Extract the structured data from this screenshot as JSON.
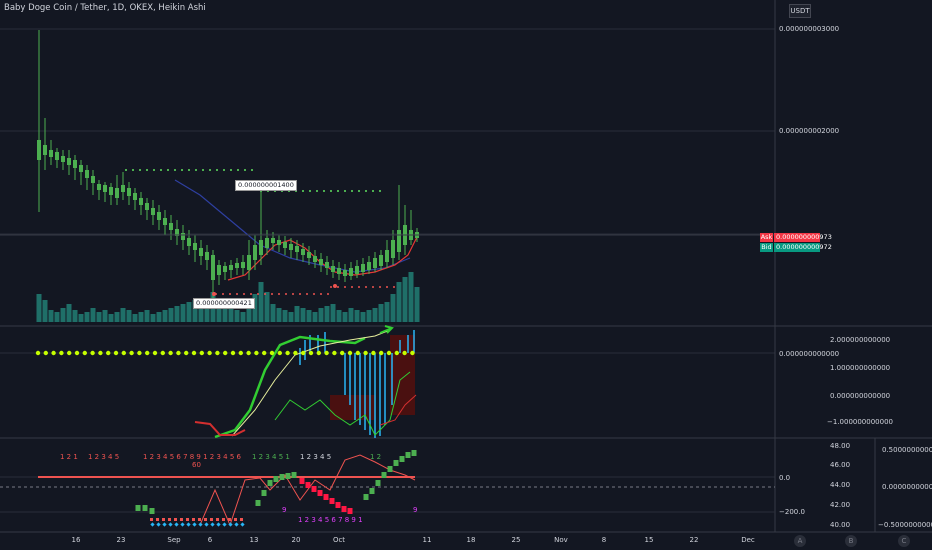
{
  "header": {
    "title": "Baby Doge Coin / Tether, 1D, OKEX, Heikin Ashi",
    "currency": "USDT"
  },
  "price_axis": [
    {
      "label": "0.000000003000"
    },
    {
      "label": "0.000000002000"
    }
  ],
  "quote": {
    "ask_tag": "Ask",
    "ask_value": "0.000000000973",
    "bid_tag": "Bid",
    "bid_value": "0.000000000972"
  },
  "callouts": {
    "high": "0.000000001400",
    "low": "0.000000000421"
  },
  "oscillator_axis": [
    "2.000000000000",
    "0.000000000000",
    "1.000000000000",
    "0.000000000000",
    "−1.000000000000"
  ],
  "indicator_axis_mid": [
    "0.0",
    "−200.0"
  ],
  "indicator_axis_right": [
    "48.00",
    "46.00",
    "44.00",
    "42.00",
    "40.00"
  ],
  "indicator_axis_far": [
    "0.500000000000",
    "0.000000000000",
    "−0.500000000000"
  ],
  "time_axis": [
    "16",
    "23",
    "Sep",
    "6",
    "13",
    "20",
    "Oct",
    "11",
    "18",
    "25",
    "Nov",
    "8",
    "15",
    "22",
    "Dec"
  ],
  "pane_buttons": [
    "A",
    "B",
    "C"
  ],
  "td_counts": {
    "red_top_1": "1 2 1",
    "red_top_2": "1 2 3 4 5",
    "red_top_3": "1 2 3 4 5 6 7 8 9 1 2 3 4 5 6",
    "red_60": "60",
    "green_top": "1 2 3 4 5 1",
    "white_top": "1 2 3 4 5",
    "green_top_2": "1 2",
    "magenta_bottom": "1 2 3 4 5 6 7 8 9 1",
    "magenta_9a": "9",
    "magenta_9b": "9"
  },
  "colors": {
    "background": "#131722",
    "up": "#26a69a",
    "down": "#ef5350",
    "bull_candle": "#4caf50",
    "bear_candle": "#8d3a2f",
    "ask": "#f23645",
    "bid": "#089981"
  }
}
